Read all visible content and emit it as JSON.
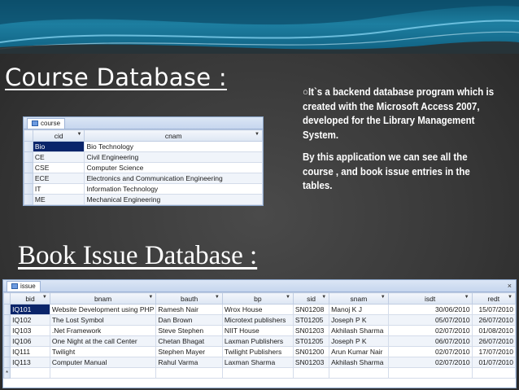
{
  "titles": {
    "course": "Course Database :",
    "issue": "Book Issue Database :"
  },
  "description": {
    "p1": "○It`s a backend database program which is created with the Microsoft Access 2007, developed for the Library Management System.",
    "p2": "By this application we can see all the course , and book issue entries in the tables."
  },
  "course_table": {
    "tab": "course",
    "columns": [
      "cid",
      "cnam"
    ],
    "rows": [
      [
        "Bio",
        "Bio Technology"
      ],
      [
        "CE",
        "Civil Engineering"
      ],
      [
        "CSE",
        "Computer Science"
      ],
      [
        "ECE",
        "Electronics and Communication Engineering"
      ],
      [
        "IT",
        "Information Technology"
      ],
      [
        "ME",
        "Mechanical Engineering"
      ]
    ]
  },
  "issue_table": {
    "tab": "issue",
    "close": "×",
    "columns": [
      "bid",
      "bnam",
      "bauth",
      "bp",
      "sid",
      "snam",
      "isdt",
      "redt"
    ],
    "rows": [
      [
        "IQ101",
        "Website Development using PHP",
        "Ramesh Nair",
        "Wrox House",
        "SN01208",
        "Manoj K J",
        "30/06/2010",
        "15/07/2010"
      ],
      [
        "IQ102",
        "The Lost Symbol",
        "Dan Brown",
        "Microtext publishers",
        "ST01205",
        "Joseph P K",
        "05/07/2010",
        "26/07/2010"
      ],
      [
        "IQ103",
        ".Net Framework",
        "Steve Stephen",
        "NIIT House",
        "SN01203",
        "Akhilash Sharma",
        "02/07/2010",
        "01/08/2010"
      ],
      [
        "IQ106",
        "One Night at the call Center",
        "Chetan Bhagat",
        "Laxman Publishers",
        "ST01205",
        "Joseph P K",
        "06/07/2010",
        "26/07/2010"
      ],
      [
        "IQ111",
        "Twilight",
        "Stephen Mayer",
        "Twilight Publishers",
        "SN01200",
        "Arun Kumar Nair",
        "02/07/2010",
        "17/07/2010"
      ],
      [
        "IQ113",
        "Computer Manual",
        "Rahul Varma",
        "Laxman Sharma",
        "SN01203",
        "Akhilash Sharma",
        "02/07/2010",
        "01/07/2010"
      ]
    ],
    "new_row_marker": "*"
  }
}
